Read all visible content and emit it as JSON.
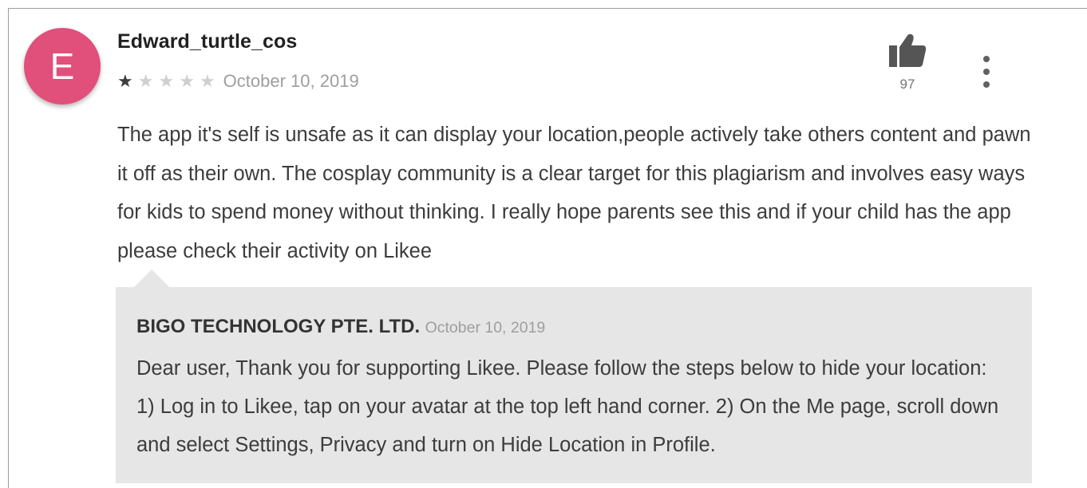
{
  "review": {
    "avatar_letter": "E",
    "avatar_color": "#e0507a",
    "username": "Edward_turtle_cos",
    "rating": 1,
    "rating_max": 5,
    "stars": {
      "s1": "★",
      "s2": "★",
      "s3": "★",
      "s4": "★",
      "s5": "★"
    },
    "date": "October 10, 2019",
    "likes": "97",
    "like_icon": "thumbs-up-icon",
    "menu_icon": "more-vertical-icon",
    "text": "The app it's self is unsafe as it can display your location,people actively take others content and pawn it off as their own. The cosplay community is a clear target for this plagiarism and involves easy ways for kids to spend money without thinking. I really hope parents see this and if your child has the app please check their activity on Likee"
  },
  "reply": {
    "developer": "BIGO TECHNOLOGY PTE. LTD.",
    "date": "October 10, 2019",
    "text": "Dear user, Thank you for supporting Likee. Please follow the steps below to hide your location: 1) Log in to Likee, tap on your avatar at the top left hand corner. 2) On the Me page, scroll down and select Settings, Privacy and turn on Hide Location in Profile.",
    "background_color": "#e6e6e6"
  }
}
